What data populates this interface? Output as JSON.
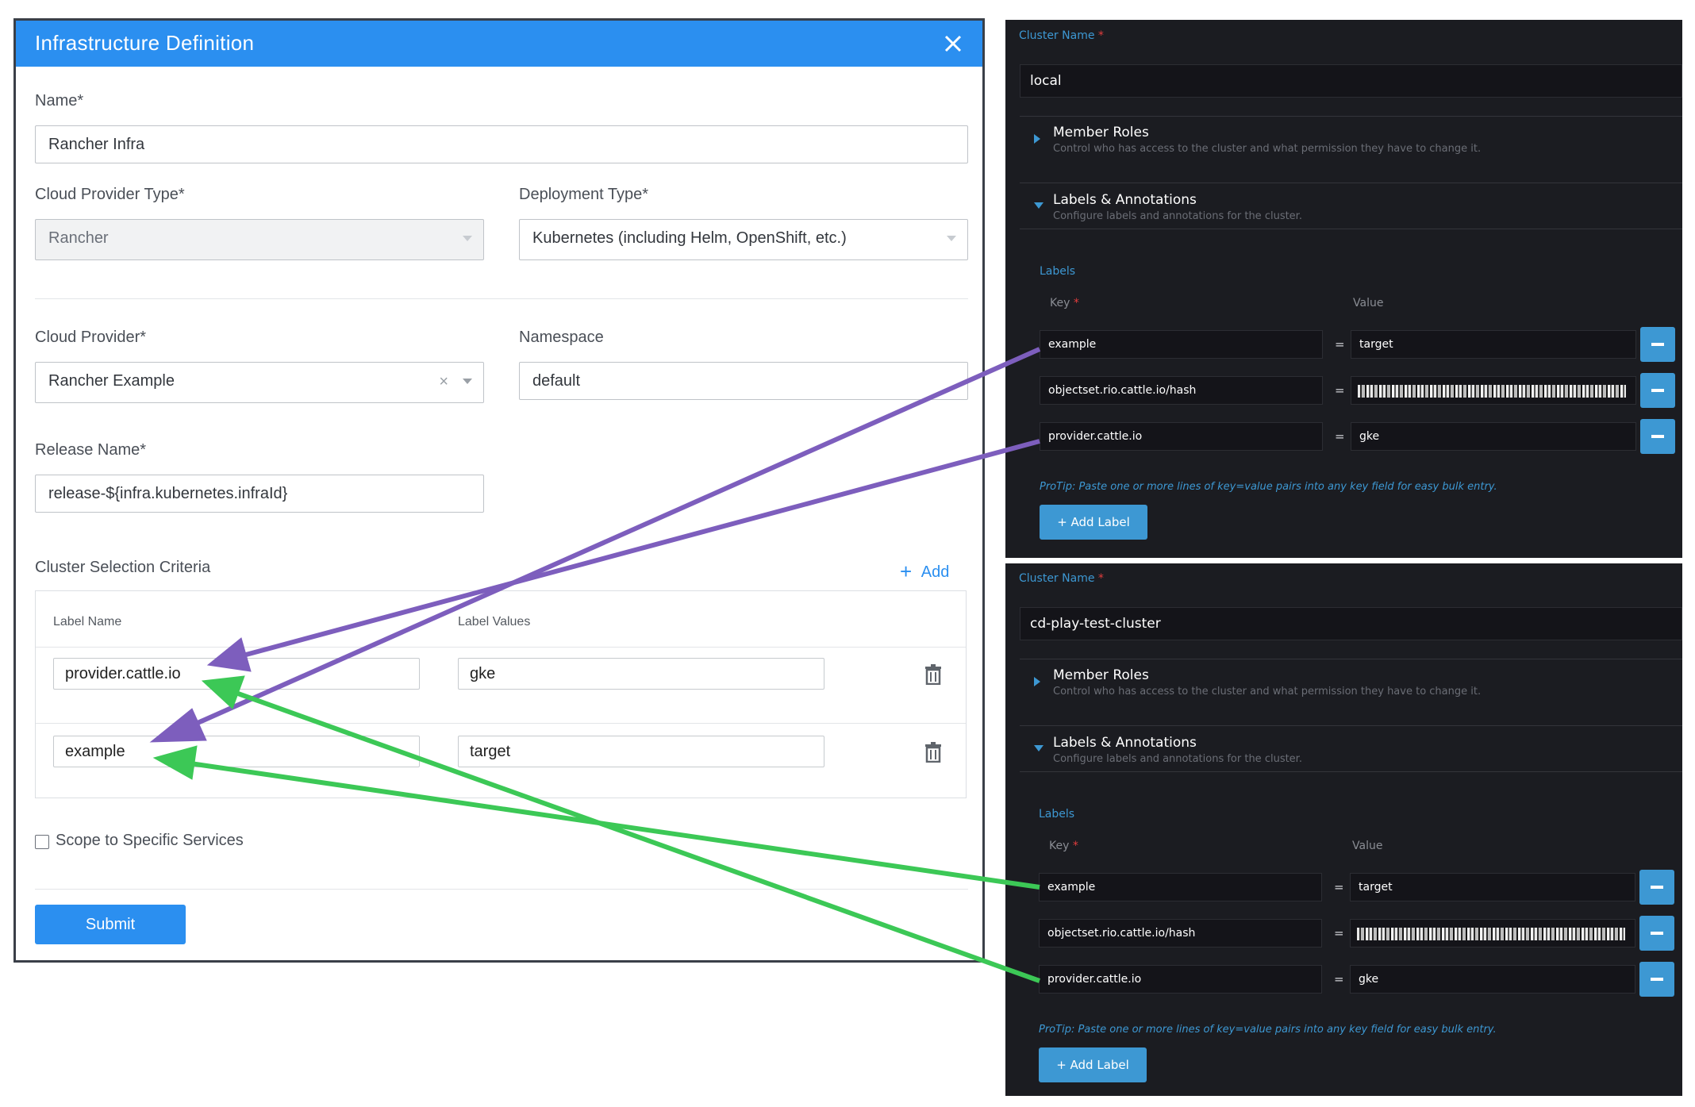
{
  "dialog": {
    "title": "Infrastructure Definition",
    "name_label": "Name*",
    "name_value": "Rancher Infra",
    "cloud_provider_type_label": "Cloud Provider Type*",
    "cloud_provider_type_value": "Rancher",
    "deployment_type_label": "Deployment Type*",
    "deployment_type_value": "Kubernetes (including Helm, OpenShift, etc.)",
    "cloud_provider_label": "Cloud Provider*",
    "cloud_provider_value": "Rancher Example",
    "namespace_label": "Namespace",
    "namespace_value": "default",
    "release_name_label": "Release Name*",
    "release_name_value": "release-${infra.kubernetes.infraId}",
    "criteria": {
      "title": "Cluster Selection Criteria",
      "add_label": "Add",
      "col_label_name": "Label Name",
      "col_label_values": "Label Values",
      "rows": [
        {
          "name": "provider.cattle.io",
          "value": "gke"
        },
        {
          "name": "example",
          "value": "target"
        }
      ]
    },
    "scope_label": "Scope to Specific Services",
    "submit_label": "Submit"
  },
  "panels": [
    {
      "cluster_name_label": "Cluster Name",
      "required_mark": "*",
      "cluster_name_value": "local",
      "member_roles_title": "Member Roles",
      "member_roles_desc": "Control who has access to the cluster and what permission they have to change it.",
      "labels_annotations_title": "Labels & Annotations",
      "labels_annotations_desc": "Configure labels and annotations for the cluster.",
      "labels_heading": "Labels",
      "key_header": "Key",
      "value_header": "Value",
      "rows": [
        {
          "key": "example",
          "eq": "=",
          "value": "target"
        },
        {
          "key": "objectset.rio.cattle.io/hash",
          "eq": "=",
          "value": ""
        },
        {
          "key": "provider.cattle.io",
          "eq": "=",
          "value": "gke"
        }
      ],
      "protip": "ProTip: Paste one or more lines of key=value pairs into any key field for easy bulk entry.",
      "add_label_button": "+ Add Label"
    },
    {
      "cluster_name_label": "Cluster Name",
      "required_mark": "*",
      "cluster_name_value": "cd-play-test-cluster",
      "member_roles_title": "Member Roles",
      "member_roles_desc": "Control who has access to the cluster and what permission they have to change it.",
      "labels_annotations_title": "Labels & Annotations",
      "labels_annotations_desc": "Configure labels and annotations for the cluster.",
      "labels_heading": "Labels",
      "key_header": "Key",
      "value_header": "Value",
      "rows": [
        {
          "key": "example",
          "eq": "=",
          "value": "target"
        },
        {
          "key": "objectset.rio.cattle.io/hash",
          "eq": "=",
          "value": ""
        },
        {
          "key": "provider.cattle.io",
          "eq": "=",
          "value": "gke"
        }
      ],
      "protip": "ProTip: Paste one or more lines of key=value pairs into any key field for easy bulk entry.",
      "add_label_button": "+ Add Label"
    }
  ],
  "annotation_colors": {
    "local_arrows": "#7d5ebd",
    "cd_play_arrows": "#3cc856"
  }
}
